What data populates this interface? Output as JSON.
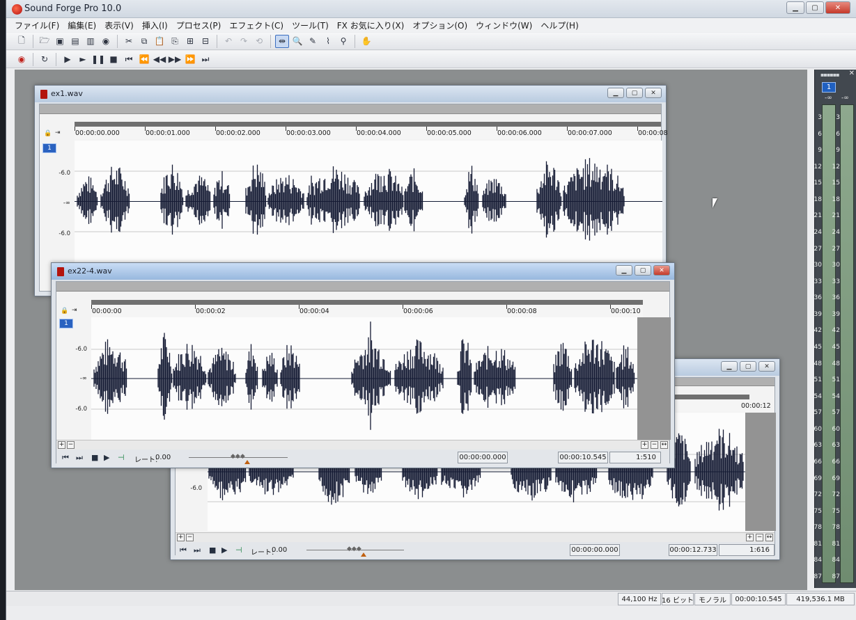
{
  "app": {
    "title": "Sound Forge Pro 10.0"
  },
  "menu": [
    "ファイル(F)",
    "編集(E)",
    "表示(V)",
    "挿入(I)",
    "プロセス(P)",
    "エフェクト(C)",
    "ツール(T)",
    "FX お気に入り(X)",
    "オプション(O)",
    "ウィンドウ(W)",
    "ヘルプ(H)"
  ],
  "toolbar1": {
    "icons": [
      "new-file-icon",
      "open-icon",
      "save-icon",
      "save-as-icon",
      "render-icon",
      "burn-icon",
      "cut-icon",
      "copy-icon",
      "paste-icon",
      "paste-special-icon",
      "mix-icon",
      "crop-icon",
      "undo-icon",
      "redo-icon",
      "repeat-icon",
      "edit-tool-icon",
      "magnify-tool-icon",
      "pencil-tool-icon",
      "envelope-tool-icon",
      "event-tool-icon",
      "script-icon"
    ]
  },
  "toolbar2": {
    "icons": [
      "record-icon",
      "loop-icon",
      "play-all-icon",
      "play-icon",
      "pause-icon",
      "stop-icon",
      "go-start-icon",
      "rewind-fast-icon",
      "rewind-icon",
      "forward-icon",
      "forward-fast-icon",
      "go-end-icon"
    ]
  },
  "meter": {
    "channel": "1",
    "peak_left": "-∞",
    "peak_right": "-∞",
    "scale": [
      "3",
      "6",
      "9",
      "12",
      "15",
      "18",
      "21",
      "24",
      "27",
      "30",
      "33",
      "36",
      "39",
      "42",
      "45",
      "48",
      "51",
      "54",
      "57",
      "60",
      "63",
      "66",
      "69",
      "72",
      "75",
      "78",
      "81",
      "84",
      "87"
    ]
  },
  "windows": {
    "ex1": {
      "title": "ex1.wav",
      "channel": "1",
      "ticks": [
        "00:00:00.000",
        "00:00:01.000",
        "00:00:02.000",
        "00:00:03.000",
        "00:00:04.000",
        "00:00:05.000",
        "00:00:06.000",
        "00:00:07.000",
        "00:00:08"
      ],
      "db_labels": [
        "-6.0",
        "-∞",
        "-6.0"
      ]
    },
    "ex22": {
      "title": "ex22-4.wav",
      "channel": "1",
      "ticks": [
        "00:00:00",
        "00:00:02",
        "00:00:04",
        "00:00:06",
        "00:00:08",
        "00:00:10"
      ],
      "db_labels": [
        "-6.0",
        "-∞",
        "-6.0"
      ],
      "rate_label": "レート:",
      "rate_value": "0.00",
      "selection_start": "00:00:00.000",
      "length": "00:00:10.545",
      "zoom": "1:510"
    },
    "back": {
      "ticks": [
        "00:00:12"
      ],
      "db_labels": [
        "-∞",
        "-6.0"
      ],
      "rate_label": "レート:",
      "rate_value": "0.00",
      "selection_start": "00:00:00.000",
      "length": "00:00:12.733",
      "zoom": "1:616"
    }
  },
  "status": {
    "sample_rate": "44,100 Hz",
    "bit_depth": "16 ビット",
    "channels": "モノラル",
    "length": "00:00:10.545",
    "disk": "419,536.1 MB"
  }
}
